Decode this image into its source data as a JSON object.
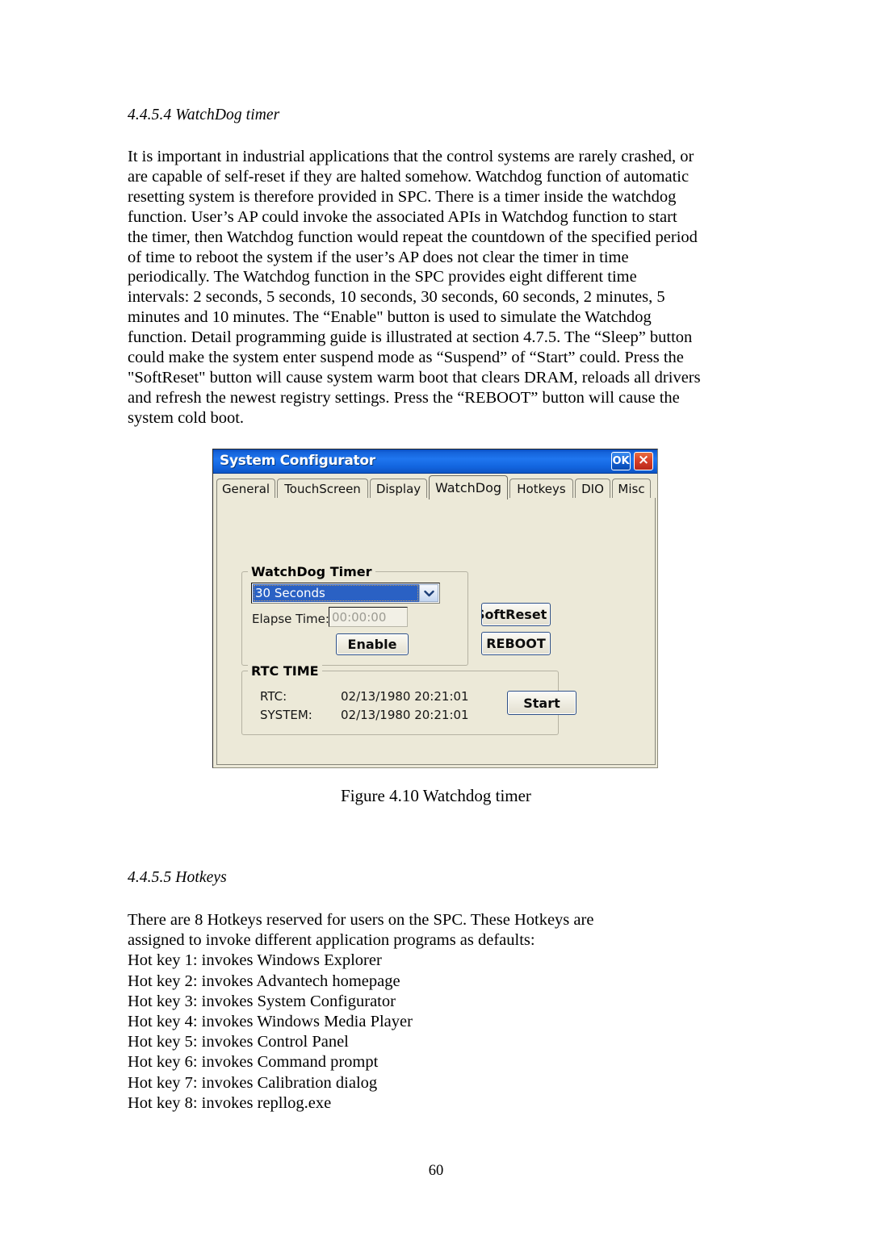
{
  "document": {
    "page_number": "60",
    "sections": [
      {
        "id": "watchdog",
        "heading": "4.4.5.4 WatchDog timer"
      },
      {
        "id": "hotkeys",
        "heading": "4.4.5.5 Hotkeys"
      }
    ],
    "watchdog_paragraph_lines": [
      "It is important in industrial applications that the control systems are rarely crashed, or",
      "are capable of self-reset if they are halted somehow. Watchdog function of automatic",
      "resetting system is therefore provided in SPC. There is a timer inside the watchdog",
      "function. User’s AP could invoke the associated APIs in Watchdog function to start",
      "the timer, then Watchdog function would repeat the countdown of the specified period",
      "of time to reboot the system if the user’s AP does not clear the timer in time",
      "periodically. The Watchdog function in the SPC provides eight different time",
      "intervals: 2 seconds, 5 seconds, 10 seconds, 30 seconds, 60 seconds, 2 minutes, 5",
      "minutes and 10 minutes. The “Enable\" button is used to simulate the Watchdog",
      "function. Detail programming guide is illustrated at section 4.7.5. The “Sleep” button",
      "could make the system enter suspend mode as “Suspend” of “Start” could. Press the",
      "\"SoftReset\" button will cause system warm boot that clears DRAM, reloads all drivers",
      "and refresh the newest registry settings. Press the “REBOOT” button will cause the",
      "system cold boot."
    ],
    "figure_caption": "Figure 4.10 Watchdog timer",
    "hotkeys_paragraph_lines": [
      "There are 8 Hotkeys reserved for users on the SPC. These Hotkeys are",
      "assigned to invoke different application programs as defaults:",
      "Hot key 1: invokes Windows Explorer",
      "Hot key 2: invokes Advantech homepage",
      "Hot key 3: invokes System Configurator",
      "Hot key 4: invokes Windows Media Player",
      "Hot key 5: invokes Control Panel",
      "Hot key 6: invokes Command prompt",
      "Hot key 7: invokes Calibration dialog",
      "Hot key 8: invokes repllog.exe"
    ]
  },
  "dialog": {
    "title": "System Configurator",
    "titlebar": {
      "ok_label": "OK",
      "close_label": "×",
      "ok_icon": "ok-button-icon",
      "close_icon": "close-x-icon",
      "gradient_start": "#1f76ef",
      "gradient_end": "#0a4ec2",
      "ok_color": "#1262d6",
      "close_color": "#d8402a"
    },
    "tabs": [
      {
        "label": "General",
        "active": false
      },
      {
        "label": "TouchScreen",
        "active": false
      },
      {
        "label": "Display",
        "active": false
      },
      {
        "label": "WatchDog",
        "active": true
      },
      {
        "label": "Hotkeys",
        "active": false
      },
      {
        "label": "DIO",
        "active": false
      },
      {
        "label": "Misc",
        "active": false
      }
    ],
    "watchdog_group": {
      "legend": "WatchDog Timer",
      "interval_selected": "30 Seconds",
      "interval_options": [
        "2 Seconds",
        "5 Seconds",
        "10 Seconds",
        "30 Seconds",
        "60 Seconds",
        "2 Minutes",
        "5 Minutes",
        "10 Minutes"
      ],
      "elapse_label": "Elapse Time:",
      "elapse_value": "00:00:00",
      "enable_label": "Enable",
      "dropdown_icon": "chevron-down-icon",
      "highlight_color": "#2a61c4"
    },
    "side_buttons": {
      "softreset_label": "SoftReset",
      "reboot_label": "REBOOT"
    },
    "rtc_group": {
      "legend": "RTC TIME",
      "rtc_label": "RTC:",
      "rtc_value": "02/13/1980 20:21:01",
      "system_label": "SYSTEM:",
      "system_value": "02/13/1980 20:21:01",
      "start_label": "Start"
    },
    "surface_color": "#ece9d8"
  }
}
